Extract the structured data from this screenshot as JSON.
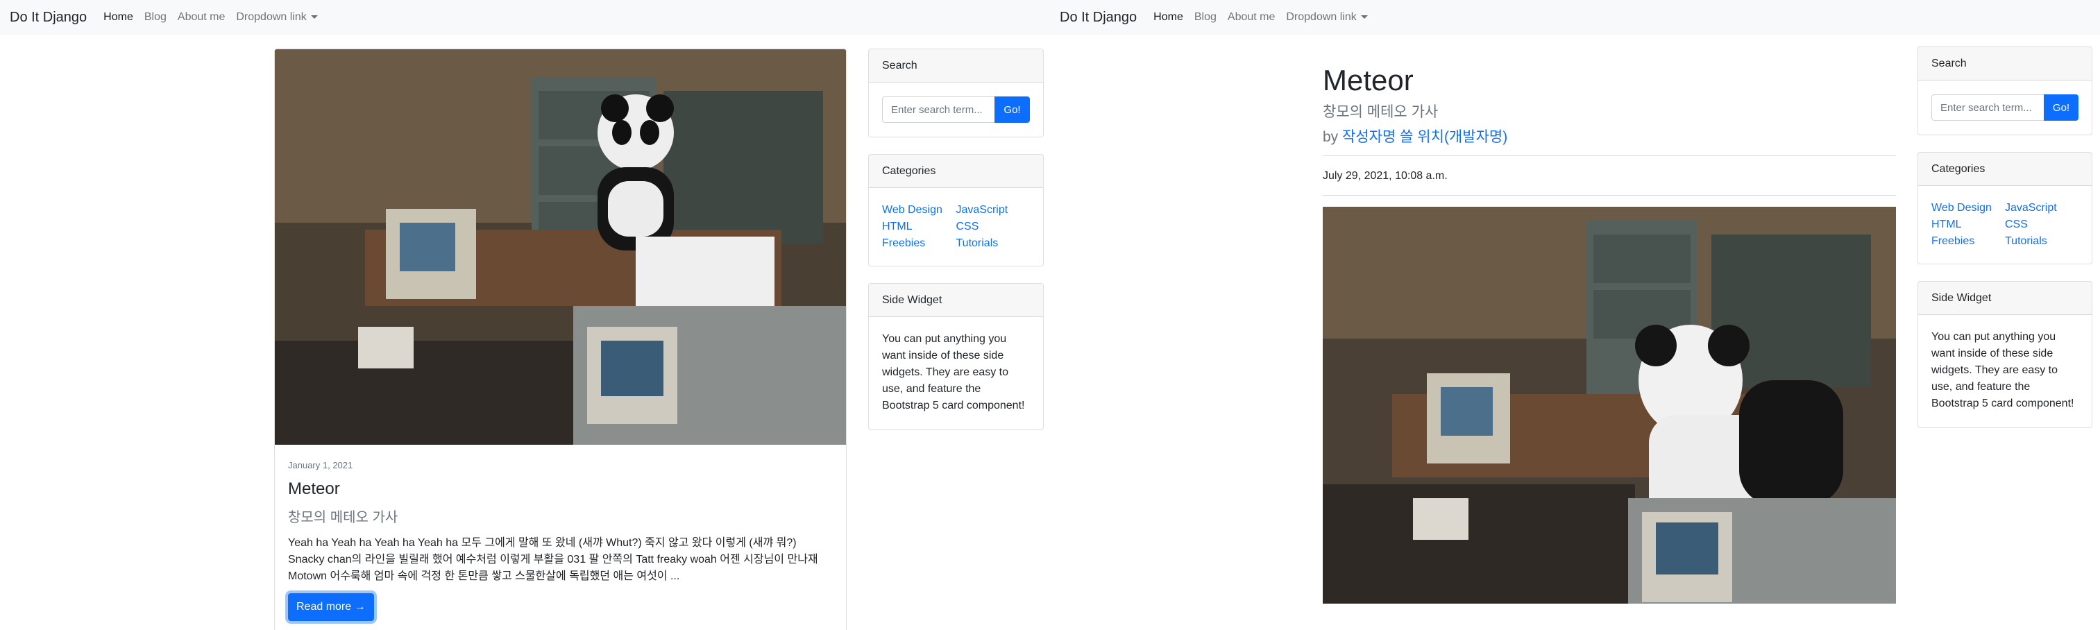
{
  "navbar": {
    "brand": "Do It Django",
    "links": [
      "Home",
      "Blog",
      "About me"
    ],
    "dropdown": "Dropdown link"
  },
  "sidebar": {
    "search": {
      "header": "Search",
      "placeholder": "Enter search term...",
      "button": "Go!"
    },
    "categories": {
      "header": "Categories",
      "items": [
        "Web Design",
        "JavaScript",
        "HTML",
        "CSS",
        "Freebies",
        "Tutorials"
      ]
    },
    "widget": {
      "header": "Side Widget",
      "text": "You can put anything you want inside of these side widgets. They are easy to use, and feature the Bootstrap 5 card component!"
    }
  },
  "list_post": {
    "date": "January 1, 2021",
    "title": "Meteor",
    "subtitle": "창모의 메테오 가사",
    "excerpt": "Yeah ha Yeah ha Yeah ha Yeah ha 모두 그에게 말해 또 왔네 (새꺄 Whut?) 죽지 않고 왔다 이렇게 (새꺄 뭐?) Snacky chan의 라인을 빌릴래 했어 예수처럼 이렇게 부활을 031 팔 안쪽의 Tatt freaky woah 어젠 시장님이 만나재 Motown 어수룩해 엄마 속에 걱정 한 톤만큼 쌓고 스물한살에 독립했던 애는 여섯이 ...",
    "read_more": "Read more →"
  },
  "detail_post": {
    "title": "Meteor",
    "subtitle": "창모의 메테오 가사",
    "by": "by",
    "author": "작성자명 쓸 위치(개발자명)",
    "published": "July 29, 2021, 10:08 a.m."
  },
  "colors": {
    "primary": "#0d6efd",
    "navbar_bg": "#f8f9fa",
    "muted": "#6c757d"
  }
}
